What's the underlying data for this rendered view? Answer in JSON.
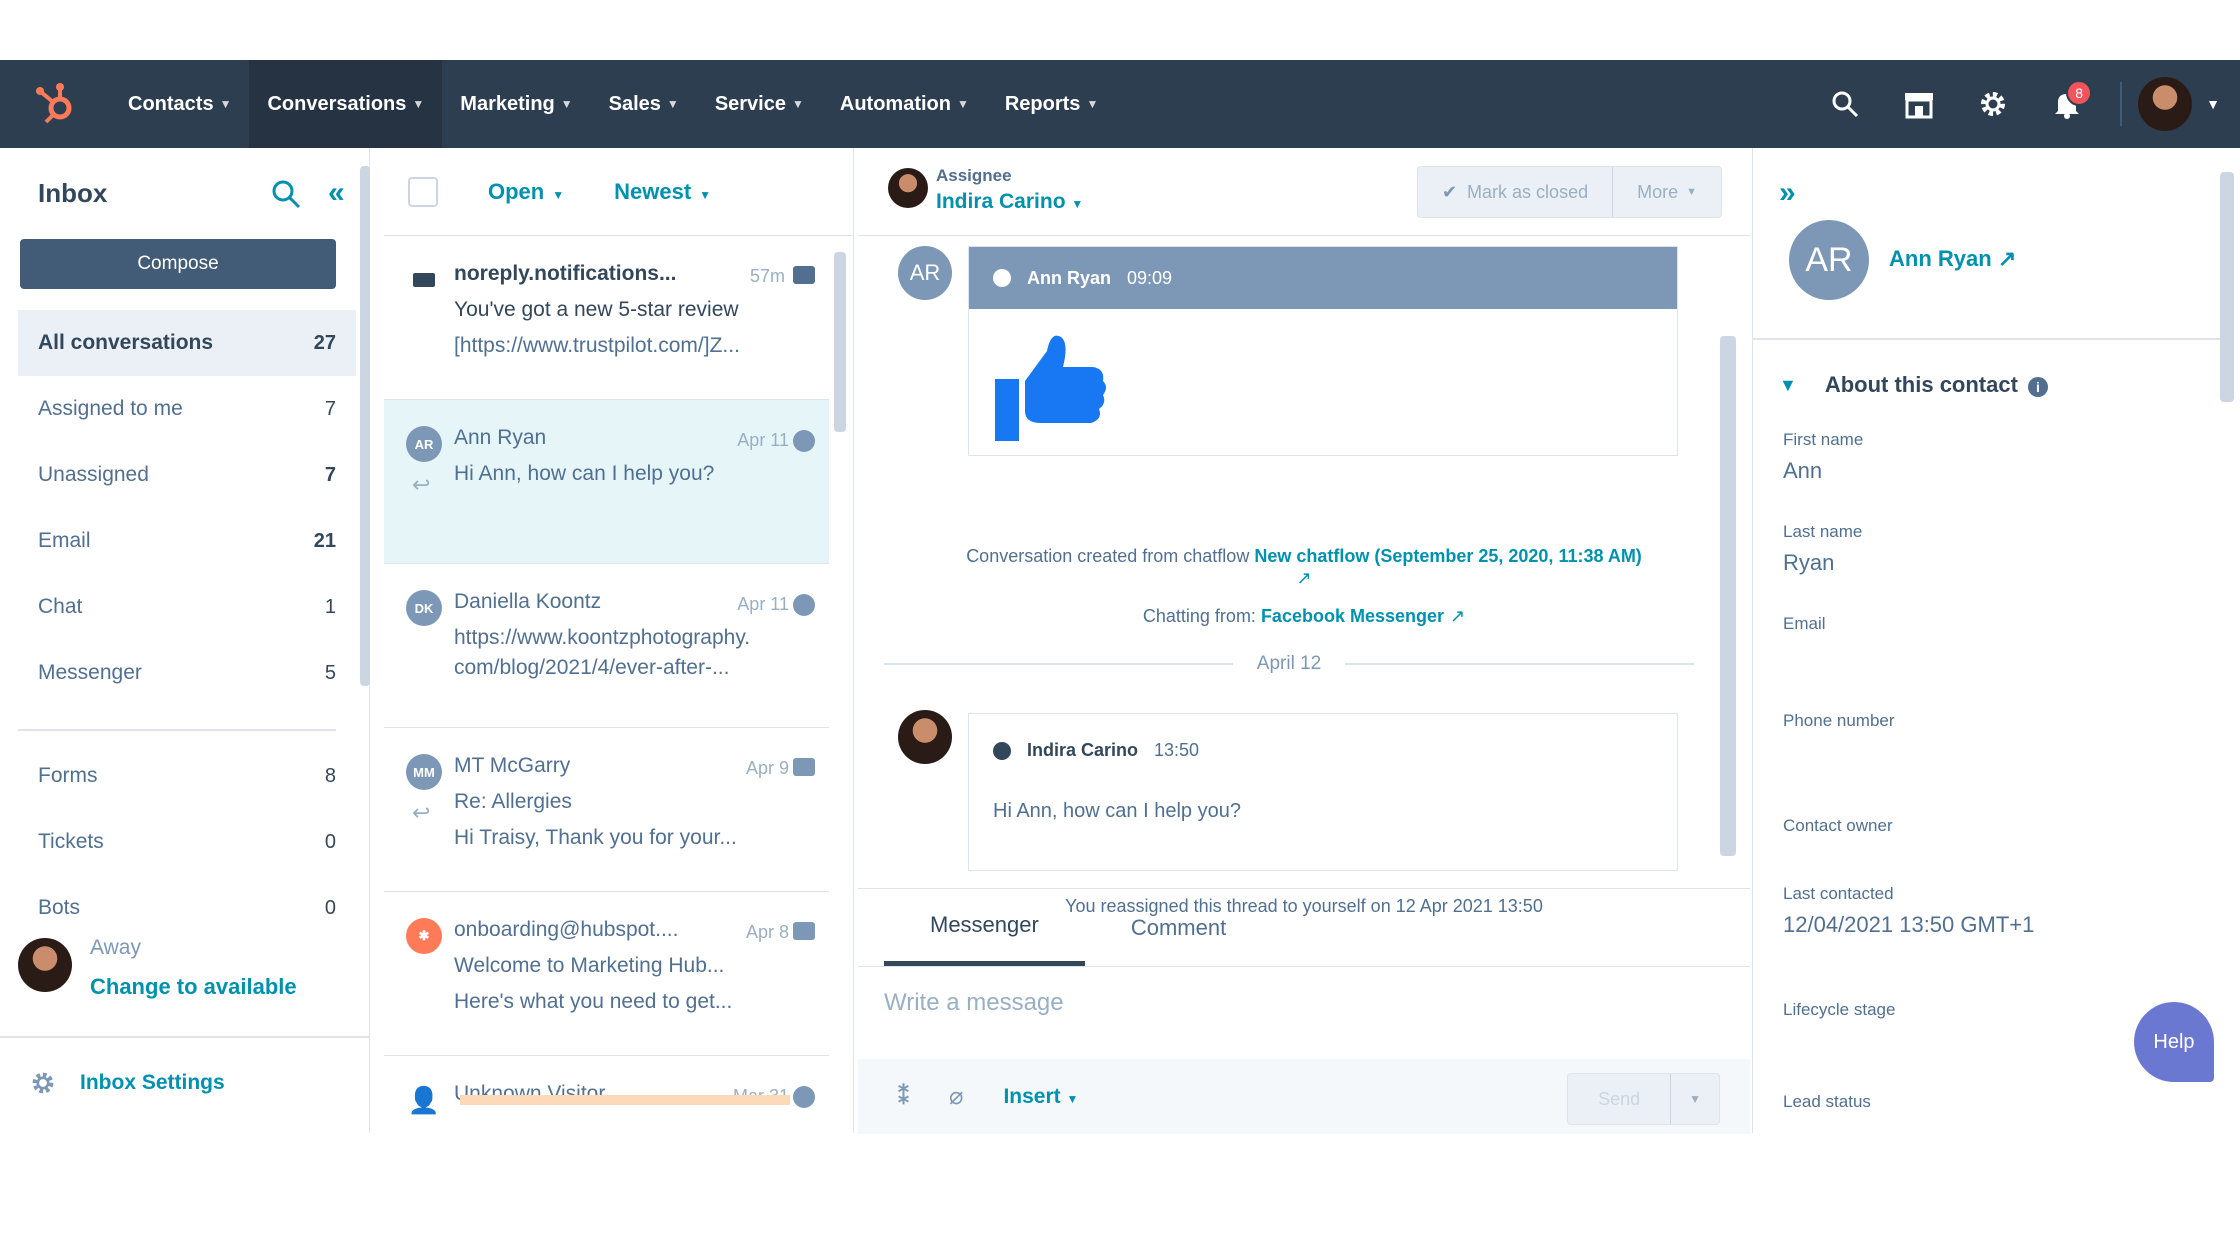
{
  "nav": {
    "items": [
      {
        "label": "Contacts"
      },
      {
        "label": "Conversations"
      },
      {
        "label": "Marketing"
      },
      {
        "label": "Sales"
      },
      {
        "label": "Service"
      },
      {
        "label": "Automation"
      },
      {
        "label": "Reports"
      }
    ],
    "notification_count": "8",
    "icons": [
      "search-icon",
      "marketplace-icon",
      "settings-gear-icon",
      "notifications-bell-icon"
    ]
  },
  "sidebar": {
    "title": "Inbox",
    "compose_label": "Compose",
    "items": [
      {
        "label": "All conversations",
        "count": "27"
      },
      {
        "label": "Assigned to me",
        "count": "7"
      },
      {
        "label": "Unassigned",
        "count": "7"
      },
      {
        "label": "Email",
        "count": "21"
      },
      {
        "label": "Chat",
        "count": "1"
      },
      {
        "label": "Messenger",
        "count": "5"
      }
    ],
    "items2": [
      {
        "label": "Forms",
        "count": "8"
      },
      {
        "label": "Tickets",
        "count": "0"
      },
      {
        "label": "Bots",
        "count": "0"
      }
    ],
    "status": "Away",
    "status_action": "Change to available",
    "settings_label": "Inbox Settings"
  },
  "convlist": {
    "filter_status": "Open",
    "filter_sort": "Newest",
    "items": [
      {
        "from": "noreply.notifications...",
        "time": "57m",
        "line1": "You've got a new 5-star review",
        "line2": "[https://www.trustpilot.com/]Z..."
      },
      {
        "initials": "AR",
        "from": "Ann Ryan",
        "time": "Apr 11",
        "line1": "Hi Ann, how can I help you?"
      },
      {
        "initials": "DK",
        "from": "Daniella Koontz",
        "time": "Apr 11",
        "line1": "https://www.koontzphotography.",
        "line2": "com/blog/2021/4/ever-after-..."
      },
      {
        "initials": "MM",
        "from": "MT McGarry",
        "time": "Apr 9",
        "line1": "Re: Allergies",
        "line2": "Hi Traisy, Thank you for your..."
      },
      {
        "from": "onboarding@hubspot....",
        "time": "Apr 8",
        "line1": "Welcome to Marketing Hub...",
        "line2": "Here's what you need to get..."
      },
      {
        "from": "Unknown Visitor",
        "time": "Mar 31"
      }
    ]
  },
  "thread": {
    "assignee_label": "Assignee",
    "assignee_name": "Indira Carino",
    "mark_closed": "Mark as closed",
    "more": "More",
    "msg1_initials": "AR",
    "msg1_sender": "Ann Ryan",
    "msg1_time": "09:09",
    "created_prefix": "Conversation created from chatflow ",
    "created_link": "New chatflow (September 25, 2020, 11:38 AM)",
    "chatting_prefix": "Chatting from: ",
    "chatting_link": "Facebook Messenger",
    "date_sep": "April 12",
    "msg2_sender": "Indira Carino",
    "msg2_time": "13:50",
    "msg2_body": "Hi Ann, how can I help you?",
    "reassigned": "You reassigned this thread to yourself on 12 Apr 2021 13:50",
    "tab_messenger": "Messenger",
    "tab_comment": "Comment",
    "placeholder": "Write a message",
    "insert": "Insert",
    "send": "Send"
  },
  "contact": {
    "initials": "AR",
    "name": "Ann Ryan",
    "about_title": "About this contact",
    "props": [
      {
        "label": "First name",
        "value": "Ann"
      },
      {
        "label": "Last name",
        "value": "Ryan"
      },
      {
        "label": "Email",
        "value": ""
      },
      {
        "label": "Phone number",
        "value": ""
      },
      {
        "label": "Contact owner",
        "value": ""
      },
      {
        "label": "Last contacted",
        "value": "12/04/2021 13:50 GMT+1"
      },
      {
        "label": "Lifecycle stage",
        "value": ""
      },
      {
        "label": "Lead status",
        "value": ""
      }
    ],
    "help": "Help"
  },
  "colors": {
    "nav": "#2d3e50",
    "accent": "#0091ae",
    "orange": "#ff7a59",
    "thumbs": "#1877f2"
  }
}
